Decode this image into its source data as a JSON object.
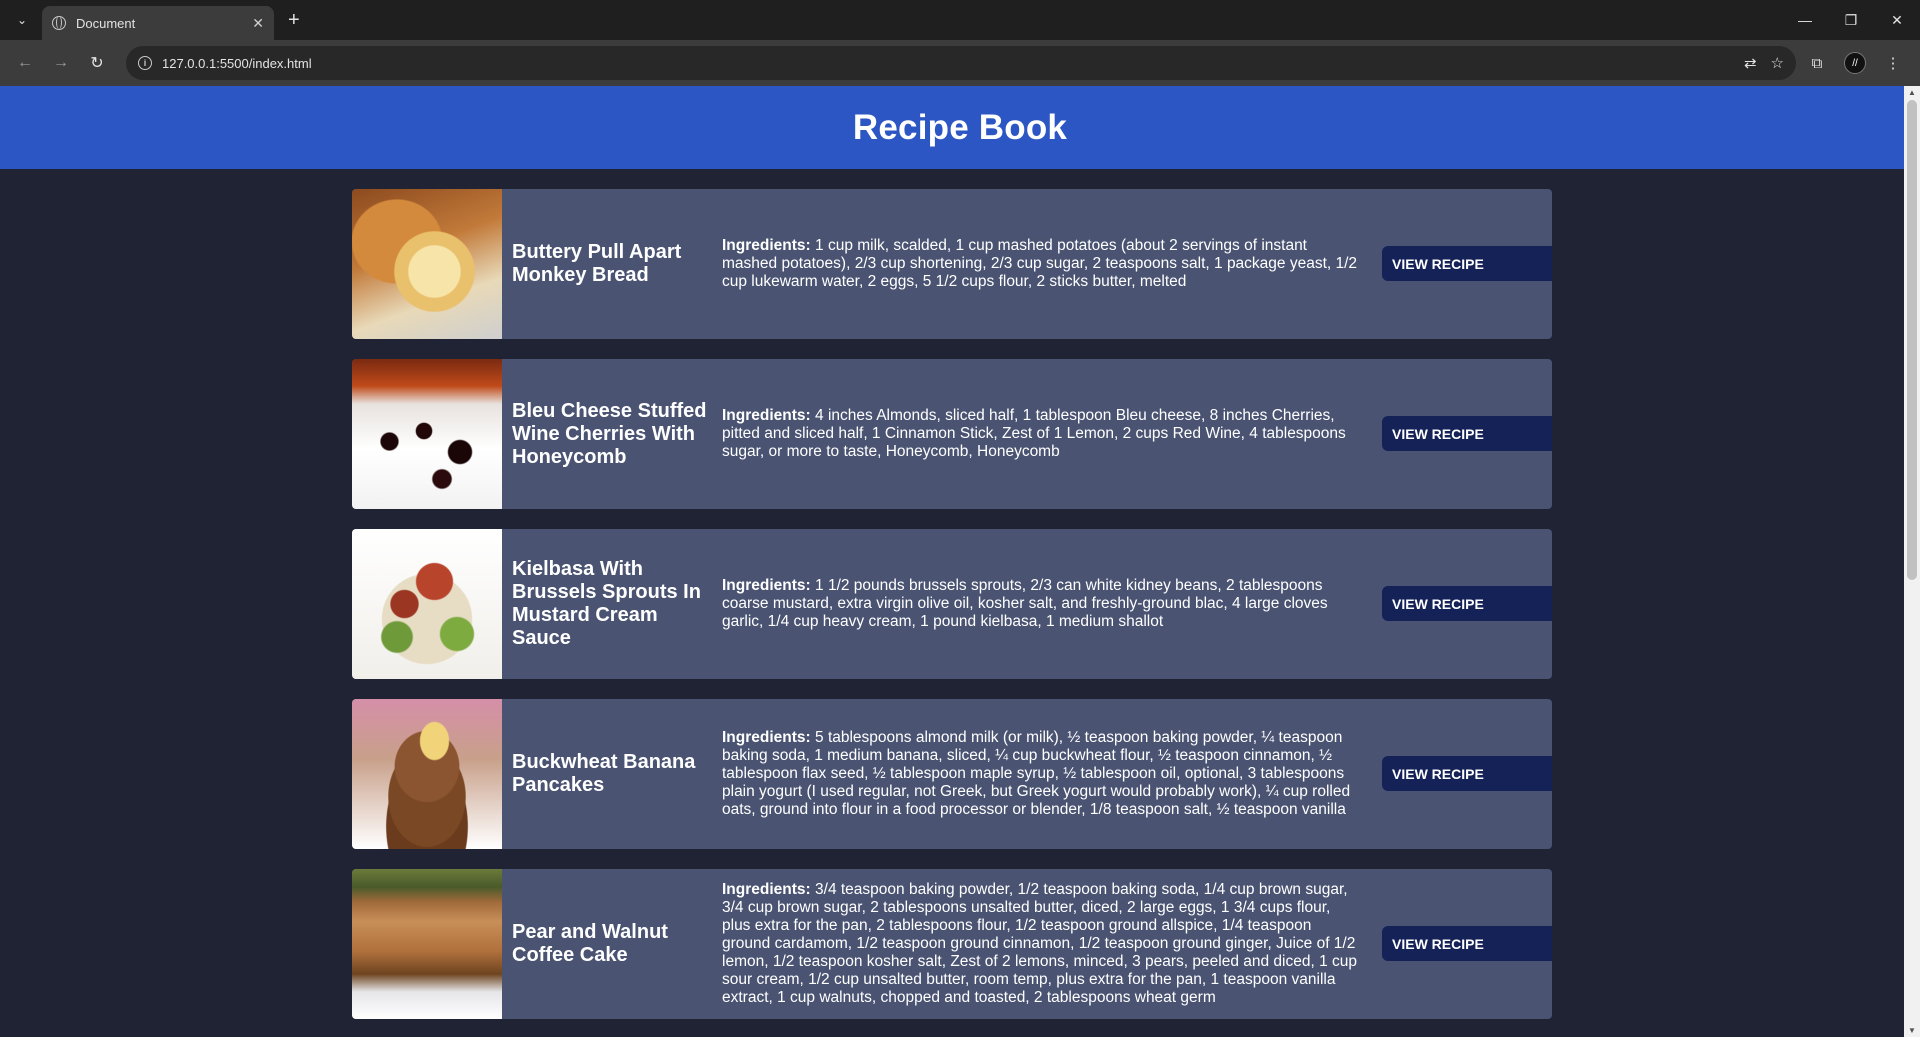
{
  "browser": {
    "tab_title": "Document",
    "url": "127.0.0.1:5500/index.html",
    "new_tab_symbol": "+",
    "tab_close_symbol": "✕",
    "window_controls": [
      "—",
      "❐",
      "✕"
    ]
  },
  "page": {
    "title": "Recipe Book",
    "ingredients_label": "Ingredients:",
    "recipes": [
      {
        "name": "Buttery Pull Apart Monkey Bread",
        "ingredients": "1 cup milk, scalded, 1 cup mashed potatoes (about 2 servings of instant mashed potatoes), 2/3 cup shortening, 2/3 cup sugar, 2 teaspoons salt, 1 package yeast, 1/2 cup lukewarm water, 2 eggs, 5 1/2 cups flour, 2 sticks butter, melted",
        "button": "VIEW RECIPE"
      },
      {
        "name": "Bleu Cheese Stuffed Wine Cherries With Honeycomb",
        "ingredients": "4 inches Almonds, sliced half, 1 tablespoon Bleu cheese, 8 inches Cherries, pitted and sliced half, 1 Cinnamon Stick, Zest of 1 Lemon, 2 cups Red Wine, 4 tablespoons sugar, or more to taste, Honeycomb, Honeycomb",
        "button": "VIEW RECIPE"
      },
      {
        "name": "Kielbasa With Brussels Sprouts In Mustard Cream Sauce",
        "ingredients": "1 1/2 pounds brussels sprouts, 2/3 can white kidney beans, 2 tablespoons coarse mustard, extra virgin olive oil, kosher salt, and freshly-ground blac, 4 large cloves garlic, 1/4 cup heavy cream, 1 pound kielbasa, 1 medium shallot",
        "button": "VIEW RECIPE"
      },
      {
        "name": "Buckwheat Banana Pancakes",
        "ingredients": "5 tablespoons almond milk (or milk), ½ teaspoon baking powder, ¼ teaspoon baking soda, 1 medium banana, sliced, ¼ cup buckwheat flour, ½ teaspoon cinnamon, ½ tablespoon flax seed, ½ tablespoon maple syrup, ½ tablespoon oil, optional, 3 tablespoons plain yogurt (I used regular, not Greek, but Greek yogurt would probably work), ¼ cup rolled oats, ground into flour in a food processor or blender, 1/8 teaspoon salt, ½ teaspoon vanilla",
        "button": "VIEW RECIPE"
      },
      {
        "name": "Pear and Walnut Coffee Cake",
        "ingredients": "3/4 teaspoon baking powder, 1/2 teaspoon baking soda, 1/4 cup brown sugar, 3/4 cup brown sugar, 2 tablespoons unsalted butter, diced, 2 large eggs, 1 3/4 cups flour, plus extra for the pan, 2 tablespoons flour, 1/2 teaspoon ground allspice, 1/4 teaspoon ground cardamom, 1/2 teaspoon ground cinnamon, 1/2 teaspoon ground ginger, Juice of 1/2 lemon, 1/2 teaspoon kosher salt, Zest of 2 lemons, minced, 3 pears, peeled and diced, 1 cup sour cream, 1/2 cup unsalted butter, room temp, plus extra for the pan, 1 teaspoon vanilla extract, 1 cup walnuts, chopped and toasted, 2 tablespoons wheat germ",
        "button": "VIEW RECIPE"
      }
    ]
  }
}
